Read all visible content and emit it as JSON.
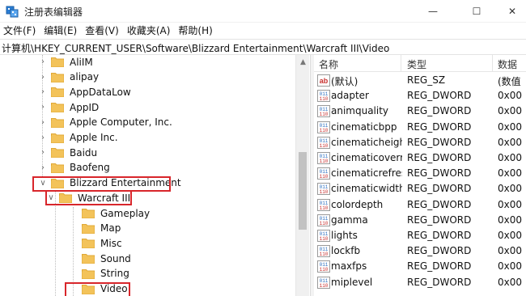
{
  "window": {
    "title": "注册表编辑器",
    "minimize_glyph": "—",
    "maximize_glyph": "☐",
    "close_glyph": "✕"
  },
  "menu": [
    "文件(F)",
    "编辑(E)",
    "查看(V)",
    "收藏夹(A)",
    "帮助(H)"
  ],
  "address": "计算机\\HKEY_CURRENT_USER\\Software\\Blizzard Entertainment\\Warcraft III\\Video",
  "tree": [
    {
      "label": "AliIM",
      "expander": "›",
      "depth": 0
    },
    {
      "label": "alipay",
      "expander": "›",
      "depth": 0
    },
    {
      "label": "AppDataLow",
      "expander": "›",
      "depth": 0
    },
    {
      "label": "AppID",
      "expander": "›",
      "depth": 0
    },
    {
      "label": "Apple Computer, Inc.",
      "expander": "›",
      "depth": 0
    },
    {
      "label": "Apple Inc.",
      "expander": "›",
      "depth": 0
    },
    {
      "label": "Baidu",
      "expander": "›",
      "depth": 0
    },
    {
      "label": "Baofeng",
      "expander": "›",
      "depth": 0
    },
    {
      "label": "Blizzard Entertainment",
      "expander": "∨",
      "depth": 0,
      "highlight": true
    },
    {
      "label": "Warcraft III",
      "expander": "∨",
      "depth": 1,
      "highlight": true
    },
    {
      "label": "Gameplay",
      "expander": "",
      "depth": 2
    },
    {
      "label": "Map",
      "expander": "",
      "depth": 2
    },
    {
      "label": "Misc",
      "expander": "",
      "depth": 2
    },
    {
      "label": "Sound",
      "expander": "",
      "depth": 2
    },
    {
      "label": "String",
      "expander": "",
      "depth": 2
    },
    {
      "label": "Video",
      "expander": "",
      "depth": 2,
      "highlight": true,
      "selected": true
    }
  ],
  "list": {
    "headers": {
      "name": "名称",
      "type": "类型",
      "data": "数据"
    },
    "rows": [
      {
        "icon": "string-value-icon",
        "name": "(默认)",
        "type": "REG_SZ",
        "data": "(数值"
      },
      {
        "icon": "dword-value-icon",
        "name": "adapter",
        "type": "REG_DWORD",
        "data": "0x00"
      },
      {
        "icon": "dword-value-icon",
        "name": "animquality",
        "type": "REG_DWORD",
        "data": "0x00"
      },
      {
        "icon": "dword-value-icon",
        "name": "cinematicbpp",
        "type": "REG_DWORD",
        "data": "0x00"
      },
      {
        "icon": "dword-value-icon",
        "name": "cinematicheight",
        "type": "REG_DWORD",
        "data": "0x00"
      },
      {
        "icon": "dword-value-icon",
        "name": "cinematicoverr...",
        "type": "REG_DWORD",
        "data": "0x00"
      },
      {
        "icon": "dword-value-icon",
        "name": "cinematicrefresh",
        "type": "REG_DWORD",
        "data": "0x00"
      },
      {
        "icon": "dword-value-icon",
        "name": "cinematicwidth",
        "type": "REG_DWORD",
        "data": "0x00"
      },
      {
        "icon": "dword-value-icon",
        "name": "colordepth",
        "type": "REG_DWORD",
        "data": "0x00"
      },
      {
        "icon": "dword-value-icon",
        "name": "gamma",
        "type": "REG_DWORD",
        "data": "0x00"
      },
      {
        "icon": "dword-value-icon",
        "name": "lights",
        "type": "REG_DWORD",
        "data": "0x00"
      },
      {
        "icon": "dword-value-icon",
        "name": "lockfb",
        "type": "REG_DWORD",
        "data": "0x00"
      },
      {
        "icon": "dword-value-icon",
        "name": "maxfps",
        "type": "REG_DWORD",
        "data": "0x00"
      },
      {
        "icon": "dword-value-icon",
        "name": "miplevel",
        "type": "REG_DWORD",
        "data": "0x00"
      }
    ]
  },
  "colors": {
    "highlight": "#d8262b",
    "folder": "#f3c35a",
    "folder_tab": "#e0a836",
    "icon_blue": "#2c6fc0",
    "icon_red": "#c8312f"
  }
}
